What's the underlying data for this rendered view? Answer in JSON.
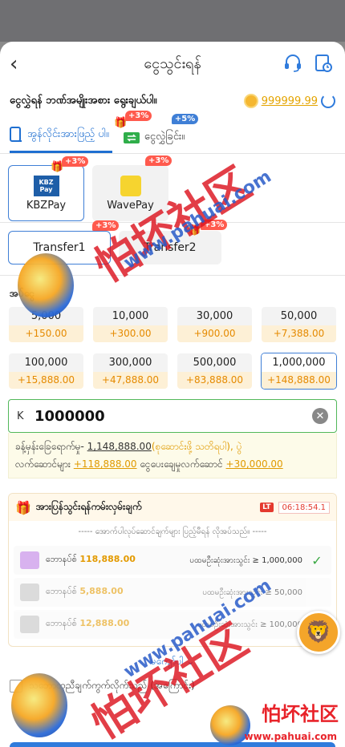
{
  "header": {
    "title": "ငွေသွင်းရန်",
    "back_icon": "chevron-left-icon",
    "support_icon": "headset-icon",
    "history_icon": "history-icon"
  },
  "subheader": {
    "label": "ငွေလွှဲရန် ဘဏ်အမျိုးအစား ရွေးချယ်ပါ။",
    "balance": "999999.99"
  },
  "tabs": [
    {
      "label": "အွန်လိုင်းအားဖြည့် ပါ။",
      "badge": "+3%",
      "active": true
    },
    {
      "label": "ငွေလွှဲခြင်း။",
      "badge": "+5%",
      "active": false
    }
  ],
  "methods": [
    {
      "label": "KBZPay",
      "logo_text": "KBZ Pay",
      "badge": "+3%",
      "selected": true
    },
    {
      "label": "WavePay",
      "badge": "+3%",
      "selected": false
    }
  ],
  "transfers": [
    {
      "label": "Transfer1",
      "badge": "+3%",
      "selected": true
    },
    {
      "label": "Transfer2",
      "badge": "+3%",
      "selected": false
    }
  ],
  "amounts_label": "အပ်ငွေ",
  "amounts": [
    {
      "value": "5,000",
      "bonus": "+150.00"
    },
    {
      "value": "10,000",
      "bonus": "+300.00"
    },
    {
      "value": "30,000",
      "bonus": "+900.00"
    },
    {
      "value": "50,000",
      "bonus": "+7,388.00"
    },
    {
      "value": "100,000",
      "bonus": "+15,888.00"
    },
    {
      "value": "300,000",
      "bonus": "+47,888.00"
    },
    {
      "value": "500,000",
      "bonus": "+83,888.00"
    },
    {
      "value": "1,000,000",
      "bonus": "+148,888.00"
    }
  ],
  "input": {
    "currency": "K",
    "value": "1000000"
  },
  "note": {
    "line1_prefix": "ခန့်မှန်းခြေရောက်မှု- ",
    "line1_amount": "1,148,888.00",
    "line1_suffix": "(စုဆောင်းဖို့ သတိရပါ), ပွဲ",
    "line2_prefix": "လက်ဆောင်များ ",
    "line2_amount": "+118,888.00",
    "line2_mid": " ငွေပေးချေမှုလက်ဆောင် ",
    "line2_amount2": "+30,000.00"
  },
  "promo": {
    "title": "အားပြန်သွင်းရန်ကမ်းလှမ်းချက်",
    "lt": "LT",
    "timer": "06:18:54.1",
    "subtitle": "----- အောက်ပါလုပ်ဆောင်ချက်များ ပြည့်မီရန် လိုအပ်သည်။ -----",
    "tiers": [
      {
        "name": "ဘောနပ်စ်",
        "amount": "118,888.00",
        "cond": "ပထမဦးဆုံးအားသွင်း ≥ 1,000,000",
        "done": true
      },
      {
        "name": "ဘောနပ်စ်",
        "amount": "5,888.00",
        "cond": "ပထမဦးဆုံးအားသွင်း ≥ 50,000",
        "done": false
      },
      {
        "name": "ဘောနပ်စ်",
        "amount": "12,888.00",
        "cond": "ပထမဦးဆုံးအားသွင်း ≥ 100,000",
        "done": false
      }
    ]
  },
  "more_label": "မကျော်ပါ",
  "agree_label": "သဘောတူညီချက်ကွက်လိုက်သည် (အကြောင်း)",
  "watermark": {
    "big": "怕坏社区",
    "url": "www.pahuai.com",
    "brand": "怕坏社区",
    "brand_url": "www.pahuai.com"
  }
}
